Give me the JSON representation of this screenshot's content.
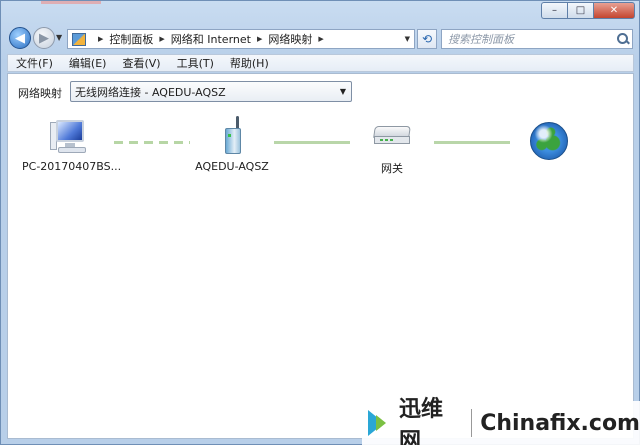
{
  "window": {
    "controls": {
      "minimize": "–",
      "maximize": "□",
      "close": "✕"
    }
  },
  "navigation": {
    "back_icon": "back-arrow-icon",
    "forward_icon": "forward-arrow-icon",
    "breadcrumbs": [
      "控制面板",
      "网络和 Internet",
      "网络映射"
    ],
    "search_placeholder": "搜索控制面板",
    "refresh_symbol": "⟲"
  },
  "menubar": {
    "items": [
      "文件(F)",
      "编辑(E)",
      "查看(V)",
      "工具(T)",
      "帮助(H)"
    ]
  },
  "content": {
    "map_label": "网络映射",
    "selected_network": "无线网络连接 - AQEDU-AQSZ",
    "nodes": [
      {
        "label": "PC-20170407BS...",
        "icon": "computer-icon"
      },
      {
        "label": "AQEDU-AQSZ",
        "icon": "wireless-router-icon"
      },
      {
        "label": "网关",
        "icon": "gateway-icon"
      },
      {
        "label": "",
        "icon": "internet-globe-icon"
      }
    ],
    "link_colors": {
      "link": "#b9d6a9"
    }
  },
  "watermark": {
    "brand_cn": "迅维网",
    "brand_en": "Chinafix.com"
  }
}
